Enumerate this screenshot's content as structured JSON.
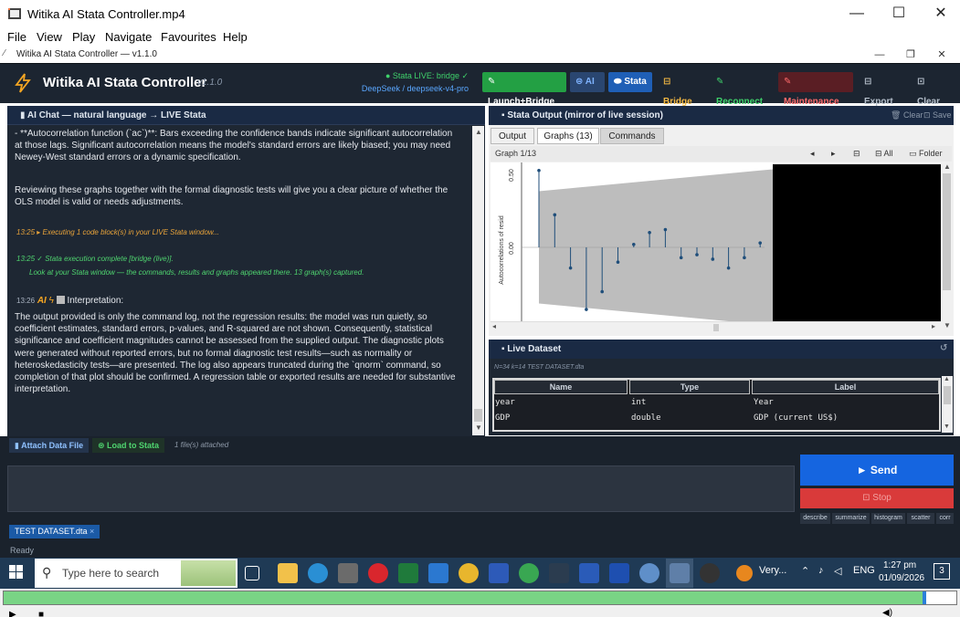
{
  "player": {
    "window_title": "Witika AI Stata Controller.mp4",
    "menu": [
      "File",
      "View",
      "Play",
      "Navigate",
      "Favourites",
      "Help"
    ],
    "seek_progress_pct": 96.3
  },
  "app_window": {
    "title": "Witika AI Stata Controller — v1.1.0"
  },
  "toolbar": {
    "title": "Witika AI Stata Controller",
    "version": "v1.1.0",
    "stata_status": "● Stata LIVE: bridge ✓",
    "model": "DeepSeek / deepseek-v4-pro",
    "buttons": {
      "launch": "Launch+Bridge",
      "ai": "AI",
      "stata": "Stata",
      "bridge": "Bridge",
      "reconnect": "Reconnect",
      "maintenance": "Maintenance",
      "export": "Export",
      "clear": "Clear"
    }
  },
  "chat": {
    "header": "AI Chat — natural language → LIVE Stata",
    "para1": "- **Autocorrelation function (`ac`)**: Bars exceeding the confidence bands indicate significant autocorrelation at those lags. Significant autocorrelation means the model's standard errors are likely biased; you may need Newey-West standard errors or a dynamic specification.",
    "para2": "Reviewing these graphs together with the formal diagnostic tests will give you a clear picture of whether the OLS model is valid or needs adjustments.",
    "sys1_time": "13:25",
    "sys1": "▸ Executing 1 code block(s) in your LIVE Stata window...",
    "sys2_time": "13:25",
    "sys2": "✓ Stata execution complete  [bridge (live)].",
    "sys3": "Look at your Stata window — the commands, results and graphs appeared there. 13 graph(s) captured.",
    "ai_time": "13:26",
    "ai_label": "AI",
    "ai_heading": "Interpretation:",
    "ai_text": "The output provided is only the command log, not the regression results: the model was run quietly, so coefficient estimates, standard errors, p-values, and R-squared are not shown. Consequently, statistical significance and coefficient magnitudes cannot be assessed from the supplied output. The diagnostic plots were generated without reported errors, but no formal diagnostic test results—such as normality or heteroskedasticity tests—are presented. The log also appears truncated during the `qnorm` command, so completion of that plot should be confirmed. A regression table or exported results are needed for substantive interpretation."
  },
  "output": {
    "header": "Stata Output (mirror of live session)",
    "clear": "Clear",
    "save": "Save",
    "tabs": [
      "Output",
      "Graphs (13)",
      "Commands"
    ],
    "graph_counter": "Graph 1/13",
    "nav_prev": "◂",
    "nav_next": "▸",
    "all": "All",
    "folder": "Folder",
    "ylabel": "Autocorrelations of resid",
    "yticks": [
      "0.50",
      "0.00"
    ]
  },
  "chart_data": {
    "type": "scatter",
    "title": "",
    "xlabel": "",
    "ylabel": "Autocorrelations of resid",
    "ylim": [
      -0.6,
      0.6
    ],
    "x": [
      1,
      2,
      3,
      4,
      5,
      6,
      7,
      8,
      9,
      10,
      11,
      12,
      13,
      14,
      15,
      16
    ],
    "values": [
      0.52,
      0.22,
      -0.14,
      -0.42,
      -0.3,
      -0.1,
      0.02,
      0.1,
      0.12,
      -0.07,
      -0.05,
      -0.08,
      -0.14,
      -0.07,
      0.03,
      -0.08
    ]
  },
  "dataset": {
    "header": "Live Dataset",
    "meta": "N=34  k=14  TEST DATASET.dta",
    "columns": [
      "Name",
      "Type",
      "Label"
    ],
    "rows": [
      [
        "year",
        "int",
        "Year"
      ],
      [
        "GDP",
        "double",
        "GDP (current US$)"
      ]
    ]
  },
  "bottom": {
    "attach": "Attach Data File",
    "load": "Load to Stata",
    "attached": "1 file(s) attached",
    "send": "►  Send",
    "stop": "Stop",
    "quick": [
      "describe",
      "summarize",
      "histogram",
      "scatter",
      "corr"
    ],
    "file_tab": "TEST DATASET.dta",
    "status": "Ready"
  },
  "taskbar": {
    "search_placeholder": "Type here to search",
    "weather": "Very...",
    "lang": "ENG",
    "time": "1:27 pm",
    "date": "01/09/2026",
    "notifications": "3"
  }
}
